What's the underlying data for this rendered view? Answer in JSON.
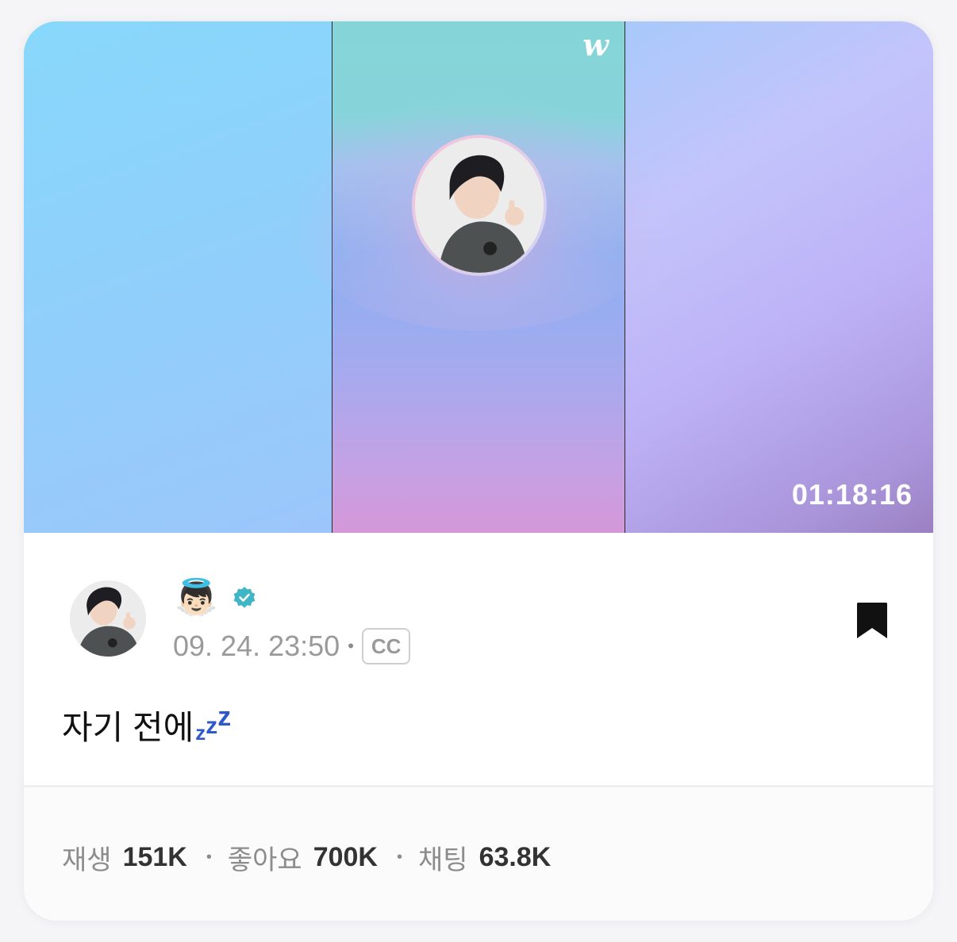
{
  "thumbnail": {
    "logo_text": "w",
    "duration": "01:18:16"
  },
  "post": {
    "author_emoji": "👼🏻",
    "verified_icon": "verified-badge-icon",
    "timestamp": "09. 24. 23:50",
    "separator": "•",
    "cc_label": "CC",
    "caption_text": "자기 전에",
    "caption_zzz": [
      "z",
      "z",
      "z"
    ],
    "bookmark_icon": "bookmark-icon"
  },
  "stats": {
    "plays_label": "재생",
    "plays_value": "151K",
    "likes_label": "좋아요",
    "likes_value": "700K",
    "chats_label": "채팅",
    "chats_value": "63.8K",
    "separator": "•"
  },
  "colors": {
    "verified": "#3fb6c6",
    "zzz": "#2f58c8",
    "bookmark": "#111111"
  }
}
